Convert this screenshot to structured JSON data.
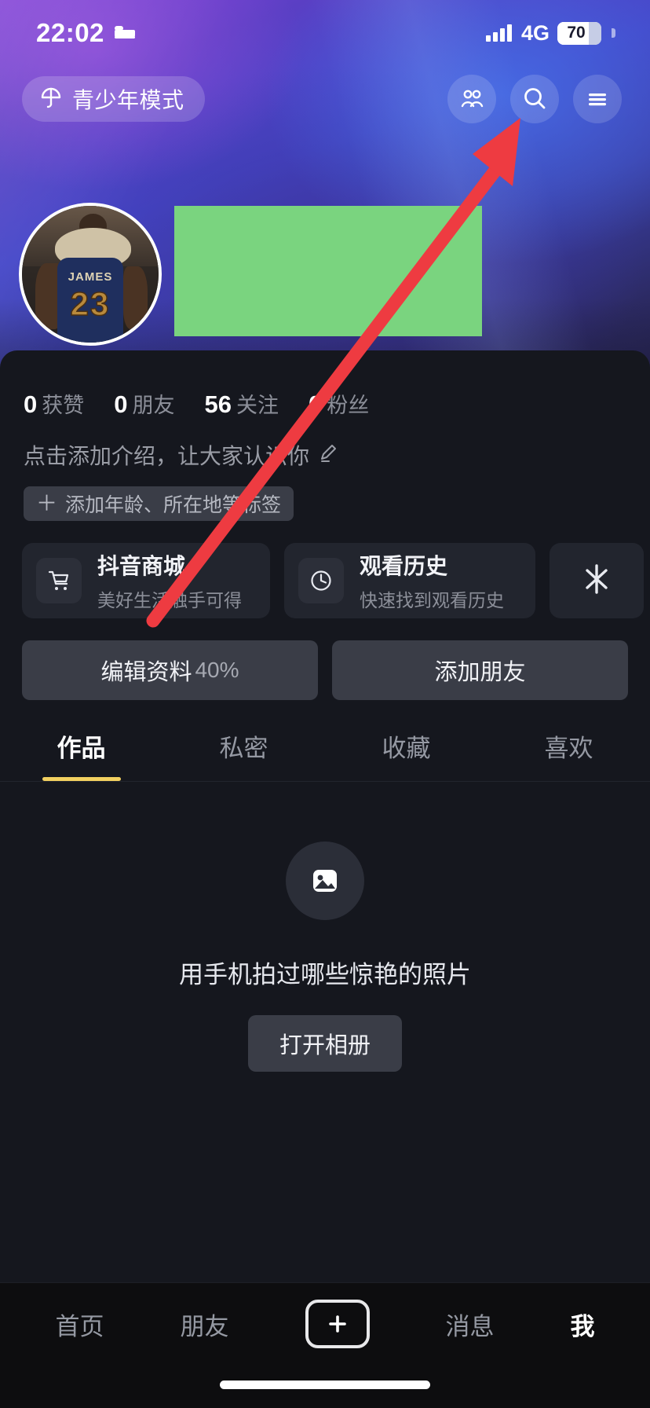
{
  "status_bar": {
    "time": "22:02",
    "alarm_icon": "bed-icon",
    "network": "4G",
    "battery_percent": "70",
    "battery_level": 70,
    "signal_bars": 4
  },
  "header": {
    "youth_mode": {
      "label": "青少年模式",
      "icon": "umbrella-icon"
    },
    "icons": [
      {
        "name": "friends-icon",
        "label": "朋友"
      },
      {
        "name": "search-icon",
        "label": "搜索"
      },
      {
        "name": "menu-icon",
        "label": "菜单"
      }
    ]
  },
  "profile": {
    "avatar": {
      "jersey_name": "JAMES",
      "jersey_number": "23"
    },
    "banner_redaction_color": "#7ad47f",
    "stats": [
      {
        "num": "0",
        "label": "获赞"
      },
      {
        "num": "0",
        "label": "朋友"
      },
      {
        "num": "56",
        "label": "关注"
      },
      {
        "num": "0",
        "label": "粉丝"
      }
    ],
    "bio_placeholder": "点击添加介绍，让大家认识你",
    "bio_edit_icon": "pencil-icon",
    "tag_button": {
      "plus": "＋",
      "label": "添加年龄、所在地等标签"
    }
  },
  "shortcut_cards": [
    {
      "icon": "cart-icon",
      "title": "抖音商城",
      "subtitle": "美好生活触手可得"
    },
    {
      "icon": "clock-icon",
      "title": "观看历史",
      "subtitle": "快速找到观看历史"
    },
    {
      "icon": "douyin-logo-icon",
      "title": "",
      "subtitle": ""
    }
  ],
  "actions": [
    {
      "label": "编辑资料",
      "suffix": "40%"
    },
    {
      "label": "添加朋友",
      "suffix": ""
    }
  ],
  "tabs": {
    "items": [
      {
        "label": "作品",
        "active": true
      },
      {
        "label": "私密",
        "active": false
      },
      {
        "label": "收藏",
        "active": false
      },
      {
        "label": "喜欢",
        "active": false
      }
    ],
    "underline_color": "#f2d060"
  },
  "empty_state": {
    "icon": "image-placeholder-icon",
    "text": "用手机拍过哪些惊艳的照片",
    "button_label": "打开相册"
  },
  "bottom_nav": {
    "items": [
      {
        "label": "首页",
        "active": false
      },
      {
        "label": "朋友",
        "active": false
      },
      {
        "label": "+",
        "active": false,
        "is_plus": true
      },
      {
        "label": "消息",
        "active": false
      },
      {
        "label": "我",
        "active": true
      }
    ]
  },
  "annotation": {
    "arrow_color": "#ee3b41",
    "points_to": "menu-icon"
  }
}
